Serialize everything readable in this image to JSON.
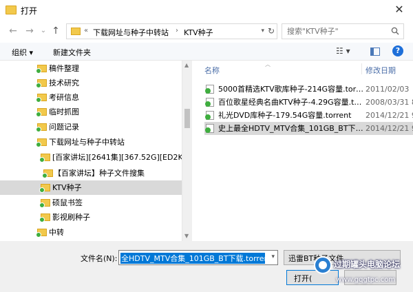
{
  "window": {
    "title": "打开"
  },
  "nav": {
    "back": "←",
    "forward": "→",
    "recent": "⌄",
    "up": "↑"
  },
  "address": {
    "prefix": "«",
    "crumbs": [
      "下载网址与种子中转站",
      "KTV种子"
    ],
    "separator": "›"
  },
  "search": {
    "placeholder": "搜索\"KTV种子\""
  },
  "toolbar": {
    "organize": "组织 ▾",
    "new_folder": "新建文件夹",
    "help": "?"
  },
  "tree": {
    "items": [
      {
        "label": "稿件整理"
      },
      {
        "label": "技术研究"
      },
      {
        "label": "考研信息"
      },
      {
        "label": "临时抓图"
      },
      {
        "label": "问题记录"
      },
      {
        "label": "下载网址与种子中转站"
      },
      {
        "label": "[百家讲坛][2641集][367.52G][ED2K]"
      },
      {
        "label": "【百家讲坛】种子文件搜集"
      },
      {
        "label": "KTV种子"
      },
      {
        "label": "硕鼠书签"
      },
      {
        "label": "影视刷种子"
      },
      {
        "label": "中转"
      }
    ]
  },
  "filelist": {
    "col_name": "名称",
    "col_date": "修改日期",
    "files": [
      {
        "name": "5000首精选KTV歌库种子-214G容量.torrent",
        "date": "2011/02/03"
      },
      {
        "name": "百位歌星经典名曲KTV种子-4.29G容量.torrent",
        "date": "2008/03/31 8"
      },
      {
        "name": "礼光DVD库种子-179.54G容量.torrent",
        "date": "2014/12/21 9"
      },
      {
        "name": "史上最全HDTV_MTV合集_101GB_BT下载.torrent",
        "date": "2014/12/21 9"
      }
    ]
  },
  "bottom": {
    "filename_label": "文件名(N):",
    "filename_value": "全HDTV_MTV合集_101GB_BT下载.torrent",
    "filetype_value": "迅雷BT种子文件",
    "open_label": "打开("
  },
  "watermark": {
    "line1": "过期罐头电脑论坛",
    "line2": "www.gqgtpc.com"
  },
  "colors": {
    "selection": "#cce4f7",
    "accent": "#0078d7",
    "folder": "#f2c94c",
    "check_green": "#3fae3f"
  }
}
